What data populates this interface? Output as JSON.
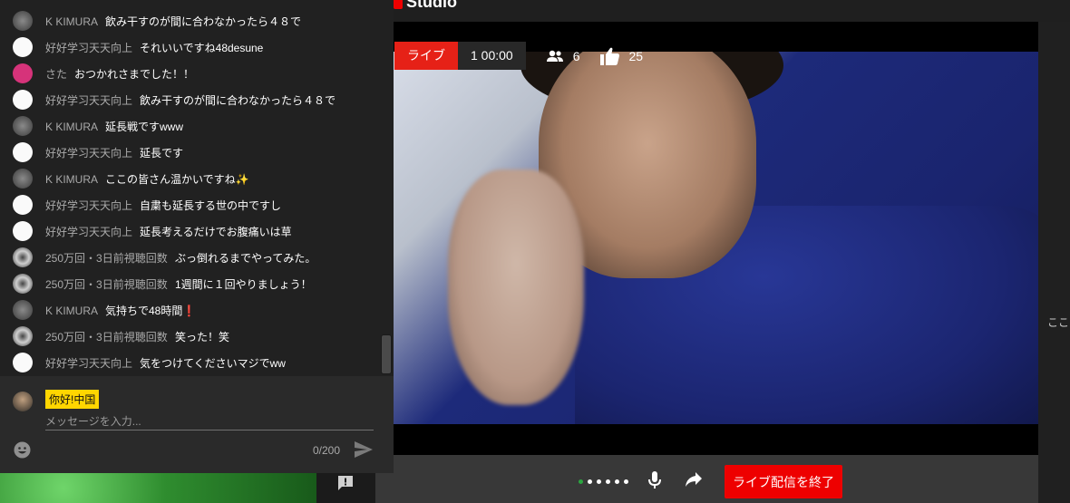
{
  "studio": {
    "logo_text": "Studio"
  },
  "stream": {
    "status_label": "ライブ",
    "elapsed": "1 00:00",
    "viewers": "6",
    "likes": "25"
  },
  "chat": {
    "partial_top_text": "",
    "messages": [
      {
        "author": "K KIMURA",
        "text": "飲み干すのが間に合わなかったら４８で",
        "avatar": "k"
      },
      {
        "author": "好好学习天天向上",
        "text": "それいいですね48desune",
        "avatar": "h"
      },
      {
        "author": "さた",
        "text": "おつかれさまでした！！",
        "avatar": "s"
      },
      {
        "author": "好好学习天天向上",
        "text": "飲み干すのが間に合わなかったら４８で",
        "avatar": "h"
      },
      {
        "author": "K KIMURA",
        "text": "延長戦ですwww",
        "avatar": "k"
      },
      {
        "author": "好好学习天天向上",
        "text": "延長です",
        "avatar": "h"
      },
      {
        "author": "K KIMURA",
        "text": "ここの皆さん温かいですね✨",
        "avatar": "k"
      },
      {
        "author": "好好学习天天向上",
        "text": "自粛も延長する世の中ですし",
        "avatar": "h"
      },
      {
        "author": "好好学习天天向上",
        "text": "延長考えるだけでお腹痛いは草",
        "avatar": "h"
      },
      {
        "author": "250万回・3日前視聴回数",
        "text": "ぶっ倒れるまでやってみた。",
        "avatar": "v"
      },
      {
        "author": "250万回・3日前視聴回数",
        "text": "1週間に１回やりましょう！",
        "avatar": "v"
      },
      {
        "author": "K KIMURA",
        "text": "気持ちで48時間❗",
        "avatar": "k"
      },
      {
        "author": "250万回・3日前視聴回数",
        "text": "笑った！笑",
        "avatar": "v"
      },
      {
        "author": "好好学习天天向上",
        "text": "気をつけてくださいマジでww",
        "avatar": "h"
      }
    ],
    "input": {
      "user_name": "你好!中国",
      "placeholder": "メッセージを入力...",
      "char_counter": "0/200"
    }
  },
  "controls": {
    "end_button_label": "ライブ配信を終了",
    "dots": 6
  },
  "right_rail": {
    "partial_text": "ここ"
  },
  "colors": {
    "live_red": "#e62117",
    "end_red": "#e00000",
    "name_badge": "#ffd600",
    "status_green": "#2ba640"
  }
}
